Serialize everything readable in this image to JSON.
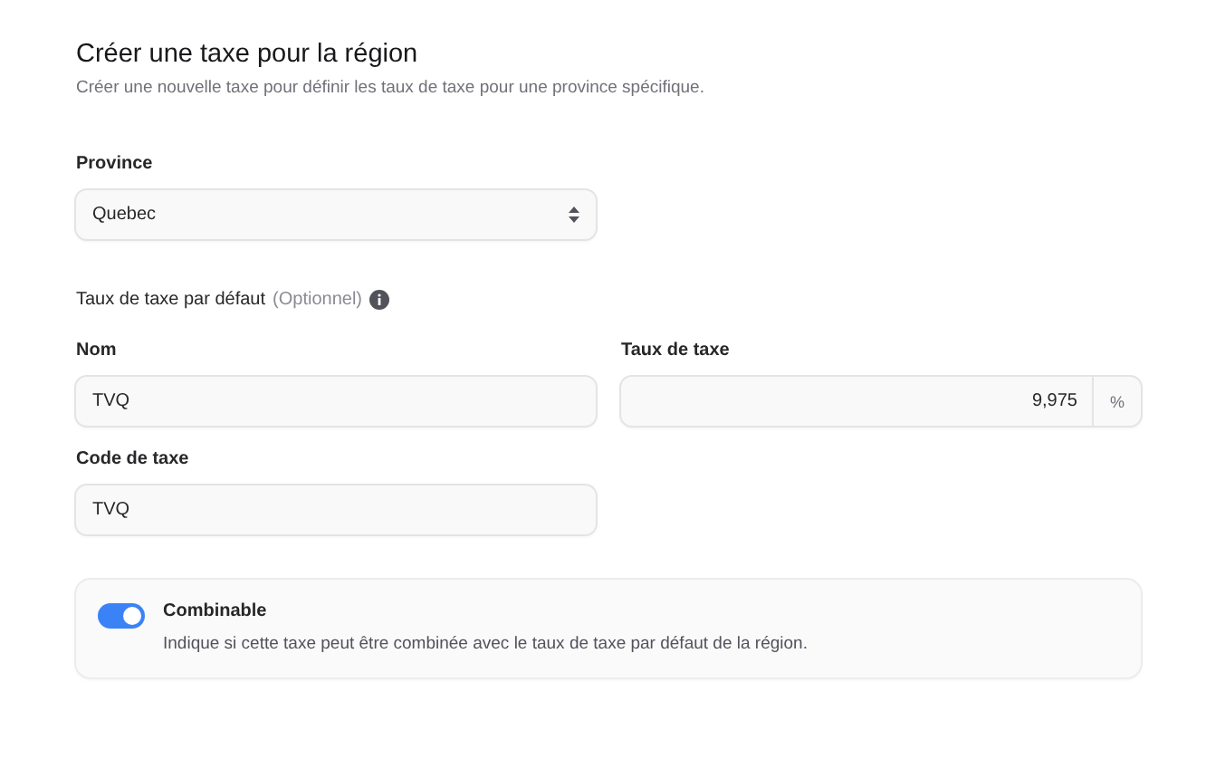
{
  "header": {
    "title": "Créer une taxe pour la région",
    "subtitle": "Créer une nouvelle taxe pour définir les taux de taxe pour une province spécifique."
  },
  "province": {
    "label": "Province",
    "value": "Quebec"
  },
  "default_rate": {
    "heading": "Taux de taxe par défaut",
    "optional": "(Optionnel)"
  },
  "fields": [
    {
      "kind": "text",
      "label": "Nom",
      "value": "TVQ"
    },
    {
      "kind": "percent",
      "label": "Taux de taxe",
      "value": "9,975",
      "suffix": "%"
    },
    {
      "kind": "text",
      "label": "Code de taxe",
      "value": "TVQ"
    }
  ],
  "combinable": {
    "label": "Combinable",
    "description": "Indique si cette taxe peut être combinée avec le taux de taxe par défaut de la région.",
    "on": true
  }
}
